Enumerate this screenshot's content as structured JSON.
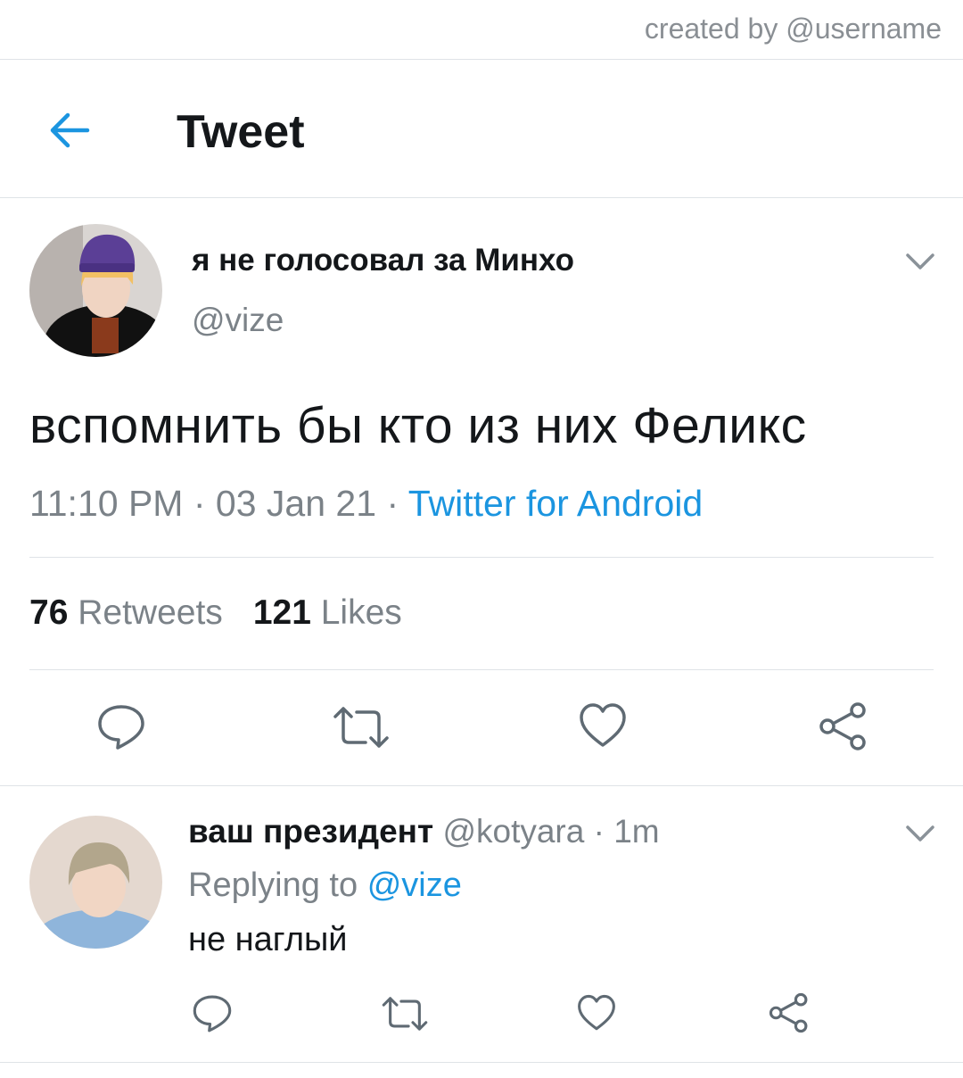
{
  "watermark": "created by @username",
  "header": {
    "title": "Tweet",
    "back_icon": "arrow-left-icon"
  },
  "tweet": {
    "display_name": "я не голосовал за Минхо",
    "handle": "@vize",
    "text": "вспомнить бы кто из них Феликс",
    "time": "11:10 PM",
    "date": "03 Jan 21",
    "source": "Twitter for Android",
    "separator": "·",
    "retweets_count": "76",
    "retweets_label": "Retweets",
    "likes_count": "121",
    "likes_label": "Likes",
    "actions": [
      "reply-icon",
      "retweet-icon",
      "like-icon",
      "share-icon"
    ]
  },
  "reply": {
    "display_name": "ваш президент",
    "handle": "@kotyara",
    "separator": "·",
    "time": "1m",
    "replying_label": "Replying to",
    "replying_to": "@vize",
    "text": "не наглый",
    "actions": [
      "reply-icon",
      "retweet-icon",
      "like-icon",
      "share-icon"
    ]
  },
  "colors": {
    "accent": "#1b95e0",
    "muted": "#7b8288",
    "text": "#14171a",
    "divider": "#dfe3e7"
  }
}
